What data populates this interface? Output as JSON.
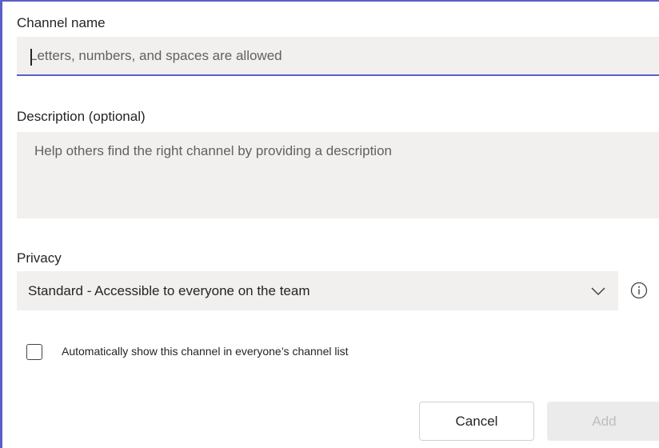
{
  "form": {
    "channel_name": {
      "label": "Channel name",
      "value": "",
      "placeholder": "Letters, numbers, and spaces are allowed"
    },
    "description": {
      "label": "Description (optional)",
      "value": "",
      "placeholder": "Help others find the right channel by providing a description"
    },
    "privacy": {
      "label": "Privacy",
      "selected": "Standard - Accessible to everyone on the team",
      "dropdown_icon": "chevron-down-icon",
      "info_icon": "info-icon"
    },
    "auto_show": {
      "label": "Automatically show this channel in everyone’s channel list",
      "checked": false
    }
  },
  "actions": {
    "cancel_label": "Cancel",
    "add_label": "Add"
  },
  "colors": {
    "accent": "#5b5fc7",
    "field_bg": "#f1f0ef",
    "disabled_bg": "#ebebeb",
    "disabled_text": "#bdbdbd"
  }
}
